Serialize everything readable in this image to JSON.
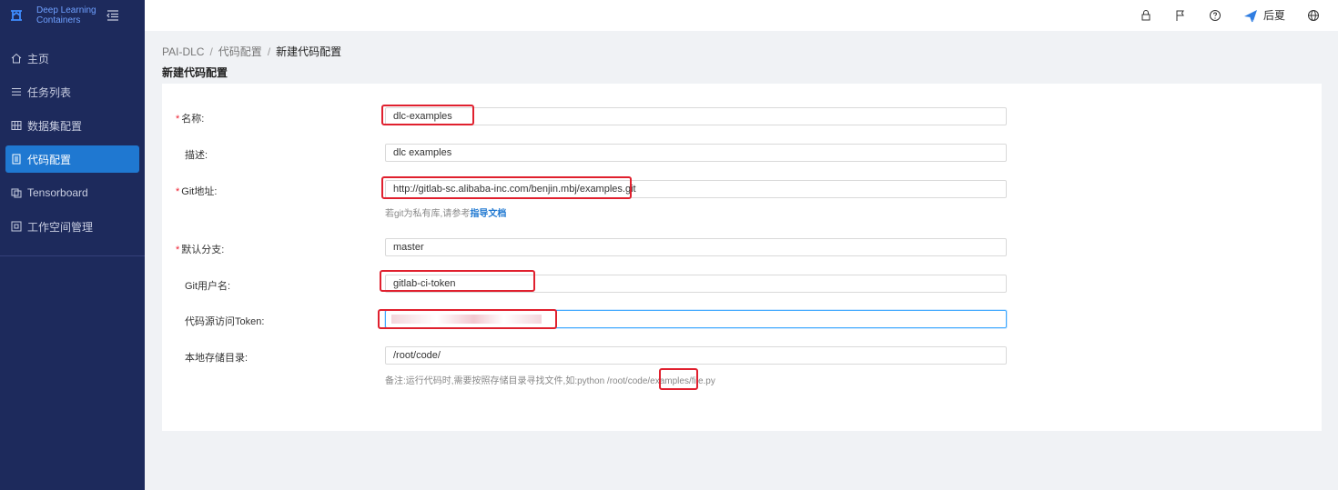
{
  "app": {
    "brand_line1": "Deep Learning",
    "brand_line2": "Containers"
  },
  "sidebar": {
    "items": [
      {
        "label": "主页",
        "icon": "home-icon"
      },
      {
        "label": "任务列表",
        "icon": "list-icon"
      },
      {
        "label": "数据集配置",
        "icon": "grid-icon"
      },
      {
        "label": "代码配置",
        "icon": "code-doc-icon",
        "active": true
      },
      {
        "label": "Tensorboard",
        "icon": "chart-icon"
      },
      {
        "label": "工作空间管理",
        "icon": "workspace-icon"
      }
    ]
  },
  "topbar": {
    "username": "后夏"
  },
  "breadcrumb": {
    "root": "PAI-DLC",
    "parent": "代码配置",
    "current": "新建代码配置"
  },
  "page": {
    "title": "新建代码配置"
  },
  "form": {
    "name": {
      "label": "名称:",
      "value": "dlc-examples",
      "required": true
    },
    "desc": {
      "label": "描述:",
      "value": "dlc examples",
      "required": false
    },
    "git_url": {
      "label": "Git地址:",
      "value": "http://gitlab-sc.alibaba-inc.com/benjin.mbj/examples.git",
      "required": true,
      "hint_prefix": "若git为私有库,请参考",
      "hint_link": "指导文档"
    },
    "branch": {
      "label": "默认分支:",
      "value": "master",
      "required": true
    },
    "git_user": {
      "label": "Git用户名:",
      "value": "gitlab-ci-token",
      "required": false
    },
    "token": {
      "label": "代码源访问Token:",
      "value": "",
      "required": false
    },
    "local_dir": {
      "label": "本地存储目录:",
      "value": "/root/code/",
      "required": false,
      "note": "备注:运行代码时,需要按照存储目录寻找文件,如:python /root/code/examples/file.py"
    }
  },
  "colors": {
    "sidebar_bg": "#1d2a5c",
    "active": "#1f78d1",
    "highlight": "#e0202e"
  }
}
